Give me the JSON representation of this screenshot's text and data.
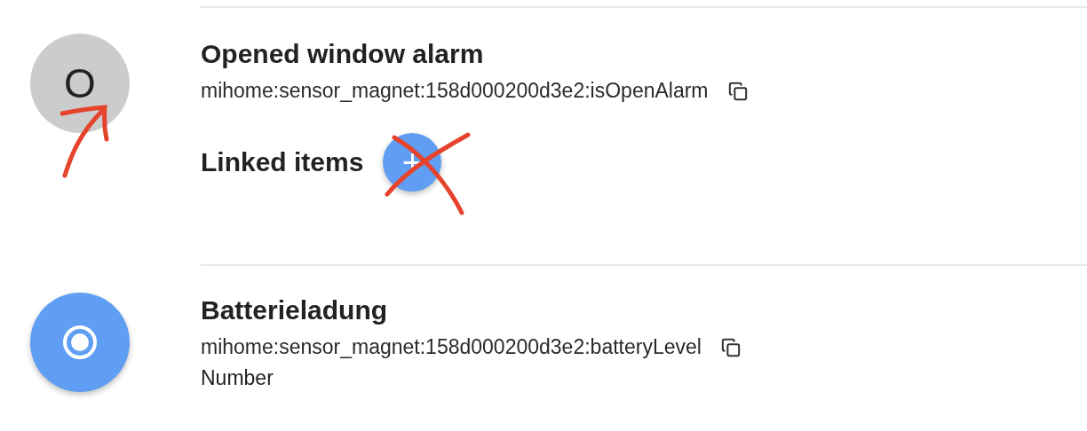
{
  "items": [
    {
      "avatar": {
        "kind": "letter",
        "text": "O"
      },
      "label": "Opened window alarm",
      "uid": "mihome:sensor_magnet:158d000200d3e2:isOpenAlarm",
      "linked_items": {
        "title": "Linked items",
        "add_button": "+"
      }
    },
    {
      "avatar": {
        "kind": "icon"
      },
      "label": "Batterieladung",
      "uid": "mihome:sensor_magnet:158d000200d3e2:batteryLevel",
      "type": "Number"
    }
  ]
}
